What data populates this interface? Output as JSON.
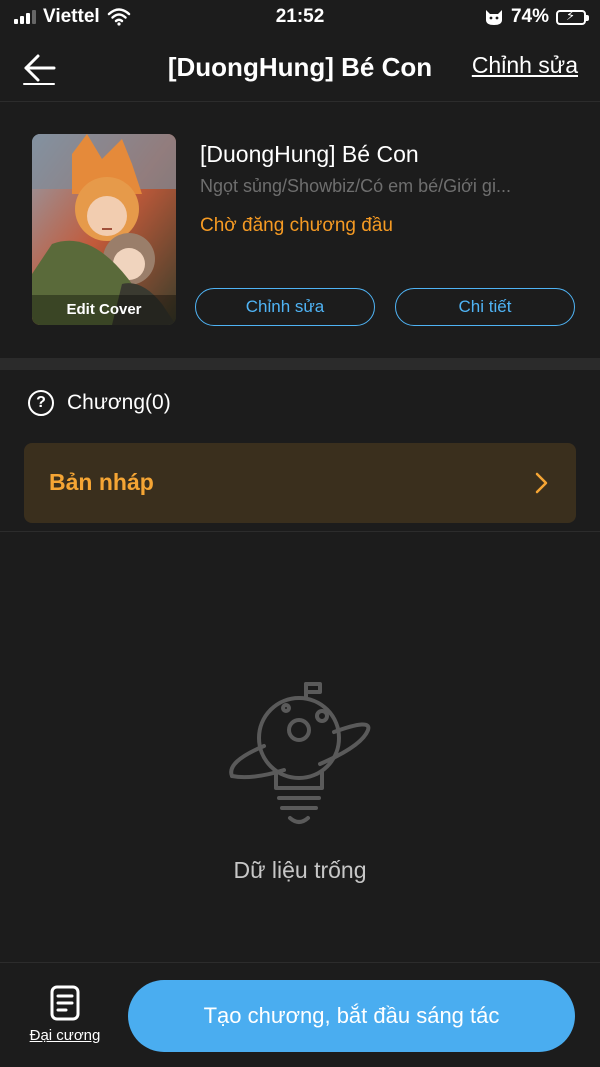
{
  "status_bar": {
    "carrier": "Viettel",
    "time": "21:52",
    "battery": "74%",
    "battery_level": 0.74,
    "icons": [
      "signal-icon",
      "wifi-icon",
      "cat-icon",
      "battery-charging-icon"
    ]
  },
  "nav": {
    "back_icon": "arrow-left-icon",
    "title": "[DuongHung] Bé Con",
    "edit_label": "Chỉnh sửa"
  },
  "book": {
    "cover_label": "Edit Cover",
    "title": "[DuongHung] Bé Con",
    "genres": "Ngọt sủng/Showbiz/Có em bé/Giới gi...",
    "status": "Chờ đăng chương đầu",
    "edit_button": "Chỉnh sửa",
    "detail_button": "Chi tiết"
  },
  "chapters": {
    "help_icon": "question-circle-icon",
    "label": "Chương(0)",
    "drafts_label": "Bản nháp",
    "drafts_icon": "chevron-right-icon"
  },
  "empty_state": {
    "illustration": "planet-lightbulb-icon",
    "text": "Dữ liệu trống"
  },
  "bottom_bar": {
    "outline_icon": "document-icon",
    "outline_label": "Đại cương",
    "create_button": "Tạo chương, bắt đầu sáng tác"
  },
  "colors": {
    "background": "#1c1c1c",
    "accent_blue": "#4aadf0",
    "accent_orange": "#f59a23",
    "drafts_background": "#3a2f1d",
    "muted_text": "#6e6e6e"
  }
}
